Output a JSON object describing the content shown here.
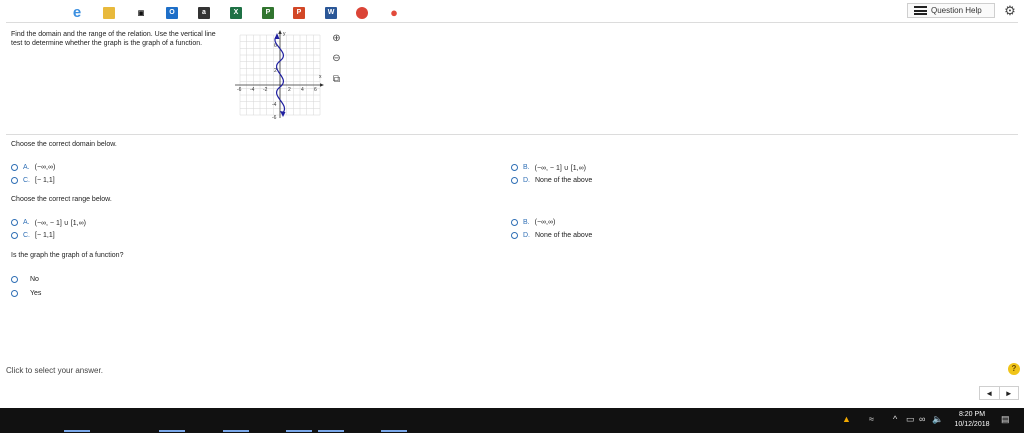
{
  "header": {
    "question_help_label": "Question Help",
    "gear_icon": "gear-icon",
    "menu_icon": "list-icon"
  },
  "problem": {
    "prompt": "Find the domain and the range of the relation. Use the vertical line test to determine whether the graph is the graph of a function."
  },
  "graph": {
    "y_axis_label": "y",
    "x_axis_label": "x",
    "x_ticks": [
      "-6",
      "-4",
      "-2",
      "2",
      "4",
      "6"
    ],
    "y_ticks": [
      "6",
      "2",
      "-4",
      "-6"
    ],
    "curve_color": "#1f1fa0",
    "zoom_in_icon": "zoom-in-icon",
    "zoom_out_icon": "zoom-out-icon",
    "popout_icon": "popout-icon"
  },
  "domain_question": {
    "prompt": "Choose the correct domain below.",
    "options": [
      {
        "letter": "A.",
        "text": "(−∞,∞)"
      },
      {
        "letter": "B.",
        "text": "(−∞, − 1] ∪ [1,∞)"
      },
      {
        "letter": "C.",
        "text": "[− 1,1]"
      },
      {
        "letter": "D.",
        "text": "None of the above"
      }
    ]
  },
  "range_question": {
    "prompt": "Choose the correct range below.",
    "options": [
      {
        "letter": "A.",
        "text": "(−∞, − 1] ∪ [1,∞)"
      },
      {
        "letter": "B.",
        "text": "(−∞,∞)"
      },
      {
        "letter": "C.",
        "text": "[− 1,1]"
      },
      {
        "letter": "D.",
        "text": "None of the above"
      }
    ]
  },
  "function_question": {
    "prompt": "Is the graph the graph of a function?",
    "options": [
      {
        "text": "No"
      },
      {
        "text": "Yes"
      }
    ]
  },
  "footer": {
    "status": "Click to select your answer.",
    "help_symbol": "?",
    "prev_symbol": "◄",
    "next_symbol": "►"
  },
  "taskbar": {
    "time": "8:20 PM",
    "date": "10/12/2018",
    "apps": [
      "start",
      "task-view",
      "edge",
      "file-explorer",
      "store",
      "outlook",
      "amazon",
      "excel",
      "project",
      "powerpoint",
      "word",
      "chrome",
      "maps"
    ]
  },
  "colors": {
    "accent": "#2f6fb5",
    "taskbar": "#111111"
  }
}
